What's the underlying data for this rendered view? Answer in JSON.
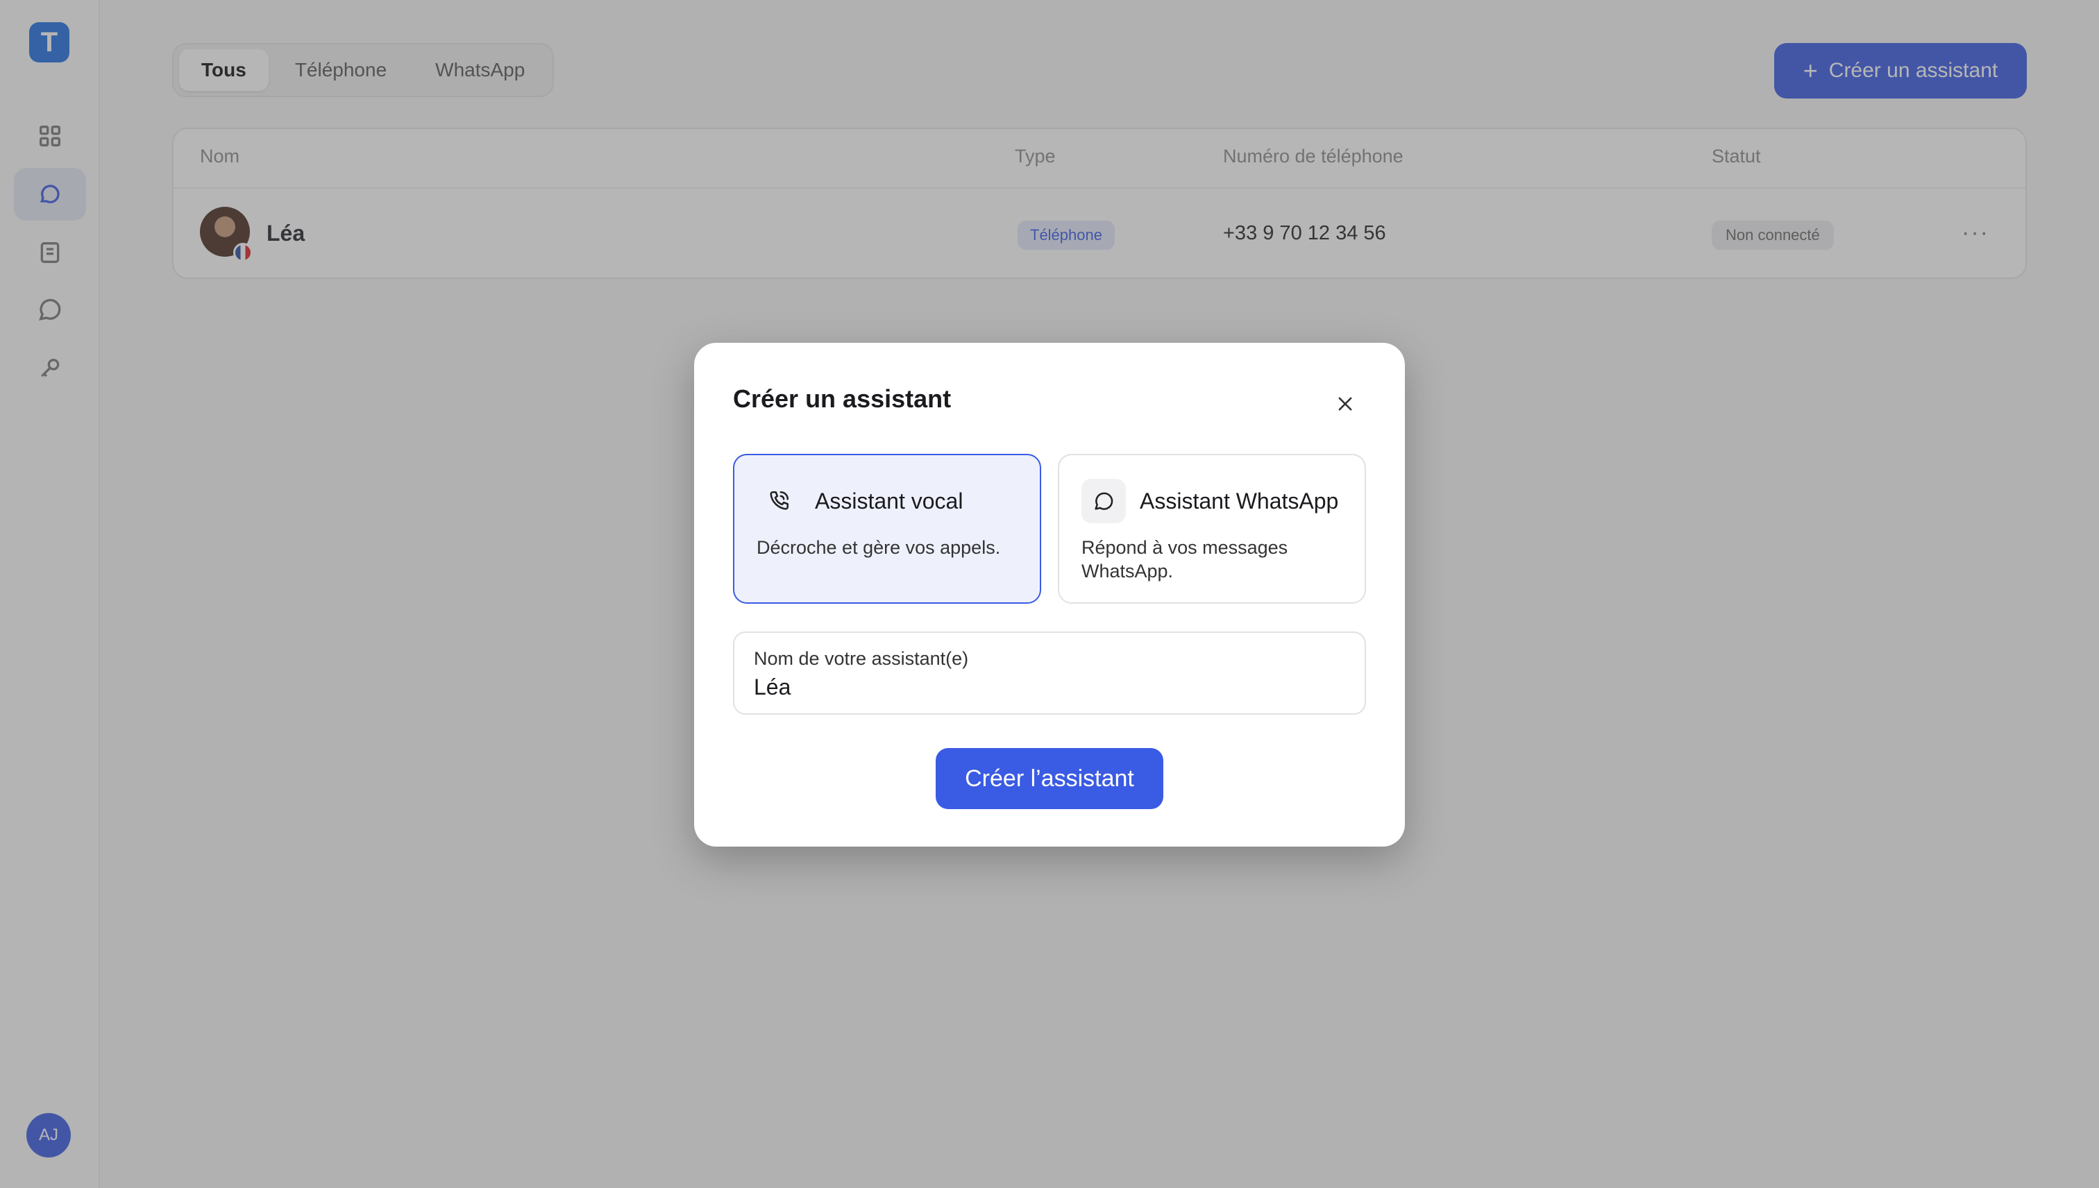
{
  "app": {
    "logo_letter": "T",
    "user_initials": "AJ",
    "accent": "#3a5be3"
  },
  "sidebar": {
    "items": [
      {
        "icon": "grid-icon"
      },
      {
        "icon": "chat-bubble-icon",
        "active": true
      },
      {
        "icon": "book-icon"
      },
      {
        "icon": "message-icon"
      },
      {
        "icon": "key-icon"
      }
    ]
  },
  "tabs": [
    {
      "label": "Tous",
      "active": true
    },
    {
      "label": "Téléphone"
    },
    {
      "label": "WhatsApp"
    }
  ],
  "header": {
    "create_button_label": "Créer un assistant",
    "create_icon": "+"
  },
  "table": {
    "columns": [
      "Nom",
      "Type",
      "Numéro de téléphone",
      "Statut"
    ],
    "rows": [
      {
        "name": "Léa",
        "type": "Téléphone",
        "phone": "+33 9 70 12 34 56",
        "status": "Non connecté",
        "more": "···"
      }
    ]
  },
  "modal": {
    "title": "Créer un assistant",
    "close_icon": "×",
    "options": [
      {
        "title": "Assistant vocal",
        "description": "Décroche et gère vos appels.",
        "icon": "phone-icon",
        "selected": true
      },
      {
        "title": "Assistant WhatsApp",
        "description": "Répond à vos messages WhatsApp.",
        "icon": "whatsapp-chat-icon",
        "selected": false
      }
    ],
    "name_field": {
      "label": "Nom de votre assistant(e)",
      "value": "Léa"
    },
    "submit_label": "Créer l’assistant"
  }
}
